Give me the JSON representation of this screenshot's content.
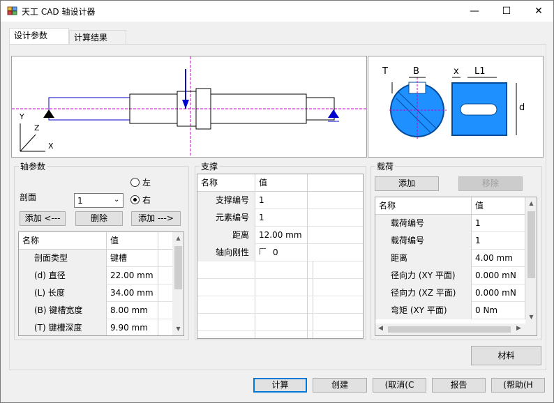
{
  "window": {
    "title": "天工 CAD 轴设计器",
    "minimize": "—",
    "maximize": "☐",
    "close": "✕"
  },
  "tabs": [
    {
      "label": "设计参数"
    },
    {
      "label": "计算结果"
    }
  ],
  "preview": {
    "axis_y": "Y",
    "axis_z": "Z",
    "axis_x": "X",
    "keyway_labels": {
      "t": "T",
      "b": "B",
      "x": "x",
      "l1": "L1",
      "d": "d"
    }
  },
  "shaft_params": {
    "title": "轴参数",
    "section_label": "剖面",
    "section_value": "1",
    "radio_left": "左",
    "radio_right": "右",
    "selected_side": "右",
    "add_left": "添加 <---",
    "delete": "删除",
    "add_right": "添加 --->",
    "headers": [
      "名称",
      "值"
    ],
    "rows": [
      {
        "name": "剖面类型",
        "value": "键槽"
      },
      {
        "name": "(d) 直径",
        "value": "22.00 mm"
      },
      {
        "name": "(L) 长度",
        "value": "34.00 mm"
      },
      {
        "name": "(B) 键槽宽度",
        "value": "8.00 mm"
      },
      {
        "name": "(T) 键槽深度",
        "value": "9.90 mm"
      }
    ]
  },
  "support": {
    "title": "支撑",
    "headers": [
      "名称",
      "值"
    ],
    "rows": [
      {
        "name": "支撑编号",
        "value": "1"
      },
      {
        "name": "元素编号",
        "value": "1"
      },
      {
        "name": "距离",
        "value": "12.00 mm"
      },
      {
        "name": "轴向刚性",
        "value": "0",
        "checkbox": true
      }
    ]
  },
  "load": {
    "title": "载荷",
    "add": "添加",
    "remove": "移除",
    "headers": [
      "名称",
      "值"
    ],
    "rows": [
      {
        "name": "载荷编号",
        "value": "1"
      },
      {
        "name": "载荷编号",
        "value": "1"
      },
      {
        "name": "距离",
        "value": "4.00 mm"
      },
      {
        "name": "径向力 (XY 平面)",
        "value": "0.000 mN"
      },
      {
        "name": "径向力 (XZ 平面)",
        "value": "0.000 mN"
      },
      {
        "name": "弯矩 (XY 平面)",
        "value": "0 Nm"
      }
    ]
  },
  "buttons": {
    "material": "材料",
    "calculate": "计算",
    "create": "创建",
    "cancel": "(取消(C",
    "report": "报告",
    "help": "(帮助(H"
  },
  "colors": {
    "accent": "#0078d7",
    "shaft_line": "#0000cc",
    "center_line": "#cc00cc",
    "keyway_blue": "#1e90ff"
  }
}
